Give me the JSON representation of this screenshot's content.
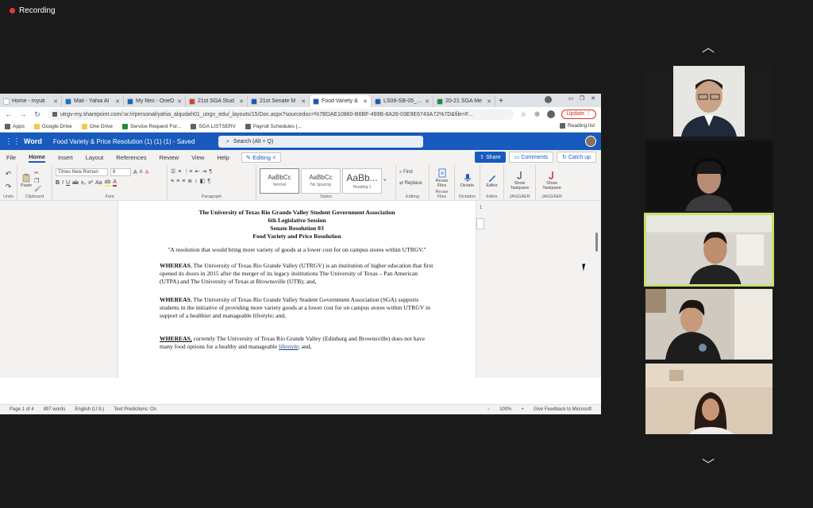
{
  "recording": {
    "label": "Recording"
  },
  "browser": {
    "tabs": [
      {
        "title": "Home - myuti",
        "color": "#ffffff",
        "active": false
      },
      {
        "title": "Mail - Yahia Al",
        "color": "#0078d4",
        "active": false
      },
      {
        "title": "My files - OneD",
        "color": "#0f6cbd",
        "active": false
      },
      {
        "title": "21st SGA Stud",
        "color": "#d24726",
        "active": false
      },
      {
        "title": "21st Senate M",
        "color": "#185abd",
        "active": false
      },
      {
        "title": "Food Variety &",
        "color": "#185abd",
        "active": true
      },
      {
        "title": "LS06-SB-05_Ca",
        "color": "#185abd",
        "active": false
      },
      {
        "title": "20-21 SGA Me",
        "color": "#1e8e3e",
        "active": false
      }
    ],
    "new_tab": "+",
    "url": "utrgv-my.sharepoint.com/:w:/r/personal/yahia_alqudah01_utrgv_edu/_layouts/15/Doc.aspx?sourcedoc=%7BDAE10860-B6BF-499B-8A26-03E9E6743A72%7D&file=F...",
    "update_label": "Update",
    "bookmarks": [
      {
        "label": "Apps",
        "color": "#5f6368"
      },
      {
        "label": "Google Drive",
        "color": "#f2c94c"
      },
      {
        "label": "One Drive",
        "color": "#f2c94c"
      },
      {
        "label": "Service Request For...",
        "color": "#1e8e3e"
      },
      {
        "label": "SGA LISTSERV",
        "color": "#5f6368"
      },
      {
        "label": "Payroll Schedules |...",
        "color": "#5f6368"
      }
    ],
    "reading_list": "Reading list"
  },
  "word": {
    "app_name": "Word",
    "doc_title": "Food Variety & Price Resolution (1) (1) (1)  -  Saved",
    "search_placeholder": "Search (Alt + Q)",
    "ribbon_tabs": [
      "File",
      "Home",
      "Insert",
      "Layout",
      "References",
      "Review",
      "View",
      "Help"
    ],
    "editing_label": "Editing",
    "share_label": "Share",
    "comments_label": "Comments",
    "catchup_label": "Catch up",
    "groups": {
      "undo": "Undo",
      "clipboard": "Clipboard",
      "paste": "Paste",
      "font": "Font",
      "font_name": "Times New Roman",
      "font_size": "8",
      "paragraph": "Paragraph",
      "styles": "Styles",
      "style_items": [
        {
          "sample": "AaBbCc",
          "label": "Normal"
        },
        {
          "sample": "AaBbCc",
          "label": "No Spacing"
        },
        {
          "sample": "AaBb...",
          "label": "Heading 1"
        }
      ],
      "editing": "Editing",
      "find": "Find",
      "replace": "Replace",
      "reuse_files": "Reuse Files",
      "reuse_files_group": "Reuse Files",
      "dictate": "Dictate",
      "dictation": "Dictation",
      "editor": "Editor",
      "editor_group": "Editor",
      "show_taskpane_1": "Show Taskpane",
      "show_taskpane_2": "Show Taskpane",
      "jagger_1": "JAGGAER",
      "jagger_2": "JAGGAER"
    },
    "document": {
      "heading_lines": [
        "The University of Texas Rio Grande Valley Student Government Association",
        "6th Legislative Session",
        "Senate Resolution 03",
        "Food Variety and Price Resolution"
      ],
      "quote": "\"A resolution that would bring more variety of goods at a lower cost for on campus stores within UTRGV.\"",
      "p1_lead": "WHEREAS",
      "p1_text": ", The University of Texas Rio Grande Valley (UTRGV) is an institution of higher education that first opened its doors in 2015 after the merger of its legacy institutions The University of Texas – Pan American (UTPA) and The University of Texas at Brownsville (UTB); and,",
      "p2_lead": "WHEREAS",
      "p2_text": ", The University of Texas Rio Grande Valley Student Government Association (SGA) supports students in the initiative of providing more variety goods at a lower cost for on campus stores within UTRGV in support of a healthier and manageable lifestyle; and,",
      "p3_lead": "WHEREAS,",
      "p3_text_a": " currently The University of Texas Rio Grande Valley (Edinburg and Brownsville) does not have many food options for a healthy and manageable ",
      "p3_link": "lifestyle",
      "p3_text_b": "; and,"
    },
    "margin_line": "1",
    "status": {
      "page": "Page 1 of 4",
      "words": "897 words",
      "language": "English (U.S.)",
      "predictions": "Text Predictions: On",
      "zoom": "100%",
      "feedback": "Give Feedback to Microsoft"
    }
  },
  "participants": {
    "count_visible": 5,
    "active_index": 2
  }
}
